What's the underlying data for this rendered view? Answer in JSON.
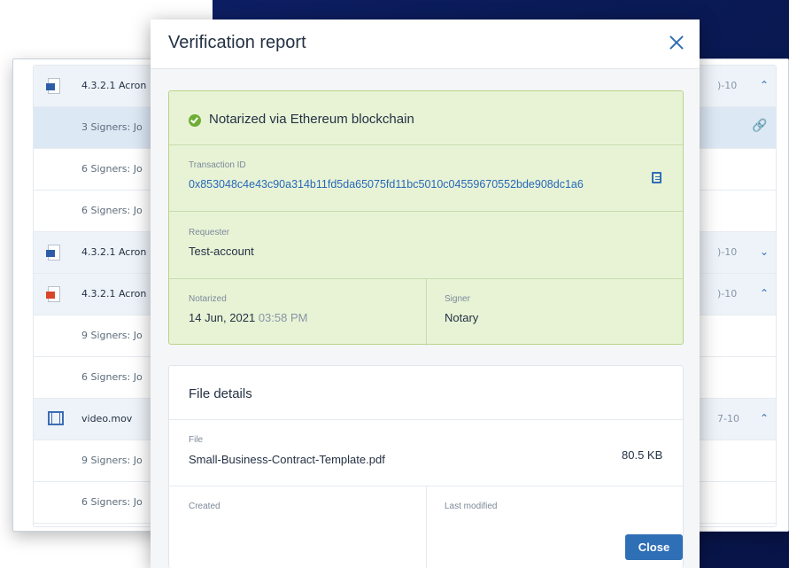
{
  "list": {
    "rows": [
      {
        "kind": "file",
        "icon": "word-doc-icon",
        "name": "4.3.2.1 Acron",
        "date": ")-10",
        "chevron": "⌃"
      },
      {
        "kind": "signer",
        "text": "3 Signers: Jo",
        "link_icon": "link-icon"
      },
      {
        "kind": "signer",
        "text": "6 Signers: Jo"
      },
      {
        "kind": "signer",
        "text": "6 Signers: Jo"
      },
      {
        "kind": "file",
        "icon": "word-doc-icon",
        "name": "4.3.2.1 Acron",
        "date": ")-10",
        "chevron": "⌄"
      },
      {
        "kind": "file",
        "icon": "pdf-doc-icon",
        "name": "4.3.2.1 Acron",
        "date": ")-10",
        "chevron": "⌃"
      },
      {
        "kind": "signer",
        "text": "9 Signers: Jo"
      },
      {
        "kind": "signer",
        "text": "6 Signers: Jo"
      },
      {
        "kind": "file",
        "icon": "video-file-icon",
        "name": "video.mov",
        "date": "7-10",
        "chevron": "⌃"
      },
      {
        "kind": "signer",
        "text": "9 Signers: Jo"
      },
      {
        "kind": "signer",
        "text": "6 Signers: Jo"
      }
    ]
  },
  "modal": {
    "title": "Verification report",
    "status": "Notarized via Ethereum blockchain",
    "transaction_label": "Transaction ID",
    "transaction_id": "0x853048c4e43c90a314b11fd5da65075fd11bc5010c04559670552bde908dc1a6",
    "requester_label": "Requester",
    "requester_value": "Test-account",
    "notarized_label": "Notarized",
    "notarized_date": "14 Jun, 2021",
    "notarized_time": "03:58 PM",
    "signer_label": "Signer",
    "signer_value": "Notary",
    "file_details_title": "File details",
    "file_label": "File",
    "file_name": "Small-Business-Contract-Template.pdf",
    "file_size": "80.5 KB",
    "created_label": "Created",
    "last_modified_label": "Last modified",
    "close_label": "Close"
  },
  "colors": {
    "accent": "#2f6fb5",
    "success_bg": "#e8f3d6",
    "success_border": "#b7d48a",
    "background_dark": "#0d1e63"
  }
}
